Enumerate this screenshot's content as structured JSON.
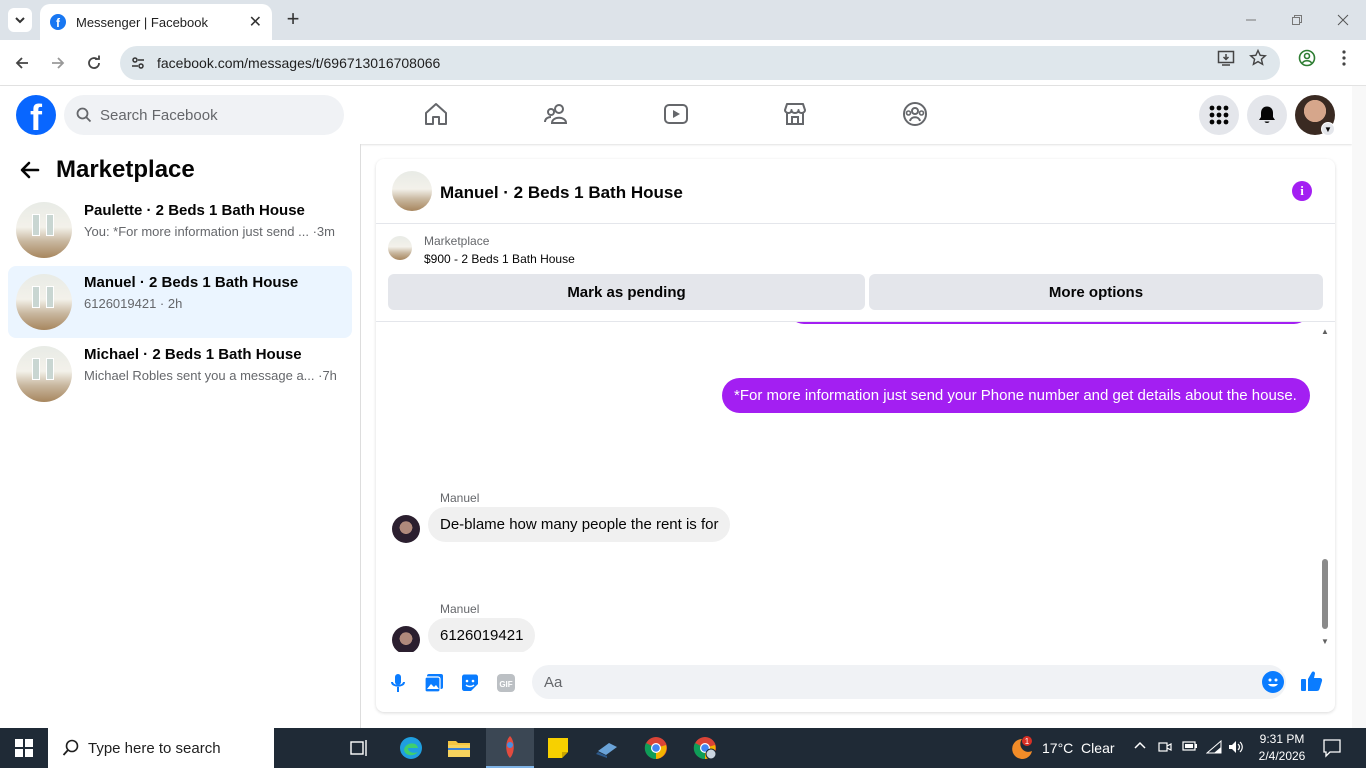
{
  "browser": {
    "tab_title": "Messenger | Facebook",
    "url": "facebook.com/messages/t/696713016708066"
  },
  "fb": {
    "logo": "f",
    "search_placeholder": "Search Facebook"
  },
  "left": {
    "title": "Marketplace",
    "conversations": [
      {
        "name": "Paulette · 2 Beds 1 Bath House",
        "preview": "You: *For more information just send ... ·3m",
        "active": false
      },
      {
        "name": "Manuel · 2 Beds 1 Bath House",
        "preview": "6126019421 · 2h",
        "active": true
      },
      {
        "name": "Michael · 2 Beds 1 Bath House",
        "preview": "Michael Robles sent you a message a... ·7h",
        "active": false
      }
    ]
  },
  "chat": {
    "title": "Manuel · 2 Beds 1 Bath House",
    "marketplace_label": "Marketplace",
    "listing": "$900 - 2 Beds 1 Bath House",
    "btn_pending": "Mark as pending",
    "btn_more": "More options",
    "outgoing": "*For more information just send your Phone number and  get details about the house.",
    "msg1_sender": "Manuel",
    "msg1_text": "De-blame how many people the rent is for",
    "msg2_sender": "Manuel",
    "msg2_text": "6126019421",
    "composer_placeholder": "Aa",
    "accent_color": "#a31ff2"
  },
  "taskbar": {
    "search_placeholder": "Type here to search",
    "weather": "17°C  Clear",
    "weather_badge": "1",
    "time": "9:31 PM",
    "date": "2/4/2026"
  }
}
